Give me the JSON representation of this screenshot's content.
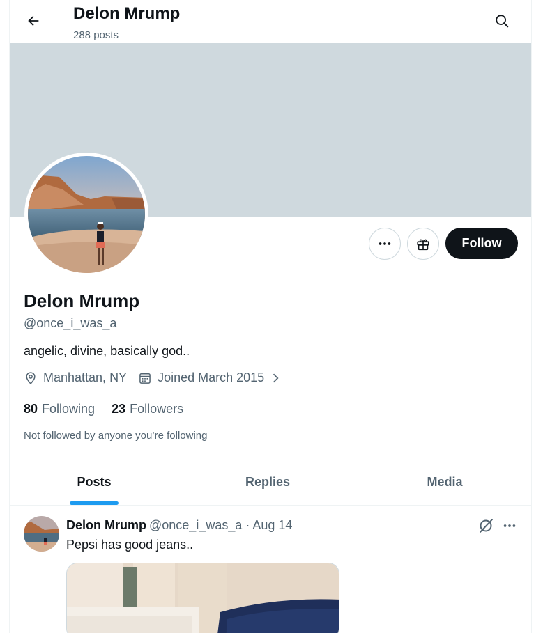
{
  "header": {
    "title": "Delon Mrump",
    "post_count": "288 posts"
  },
  "profile": {
    "name": "Delon Mrump",
    "handle": "@once_i_was_a",
    "bio": "angelic, divine, basically god..",
    "location": "Manhattan, NY",
    "joined": "Joined March 2015",
    "following_count": "80",
    "following_label": "Following",
    "followers_count": "23",
    "followers_label": "Followers",
    "not_followed_text": "Not followed by anyone you’re following",
    "follow_label": "Follow"
  },
  "tabs": [
    {
      "label": "Posts",
      "active": true
    },
    {
      "label": "Replies",
      "active": false
    },
    {
      "label": "Media",
      "active": false
    }
  ],
  "tweet": {
    "author": "Delon Mrump",
    "meta": "@once_i_was_a · Aug 14",
    "text": "Pepsi has good jeans.."
  },
  "colors": {
    "accent": "#1d9bf0",
    "banner": "#cfd9de",
    "text_primary": "#0f1419",
    "text_secondary": "#536471"
  },
  "icons": [
    "back-arrow-icon",
    "search-icon",
    "more-icon",
    "gift-icon",
    "location-icon",
    "calendar-icon",
    "chevron-right-icon",
    "grok-icon"
  ]
}
